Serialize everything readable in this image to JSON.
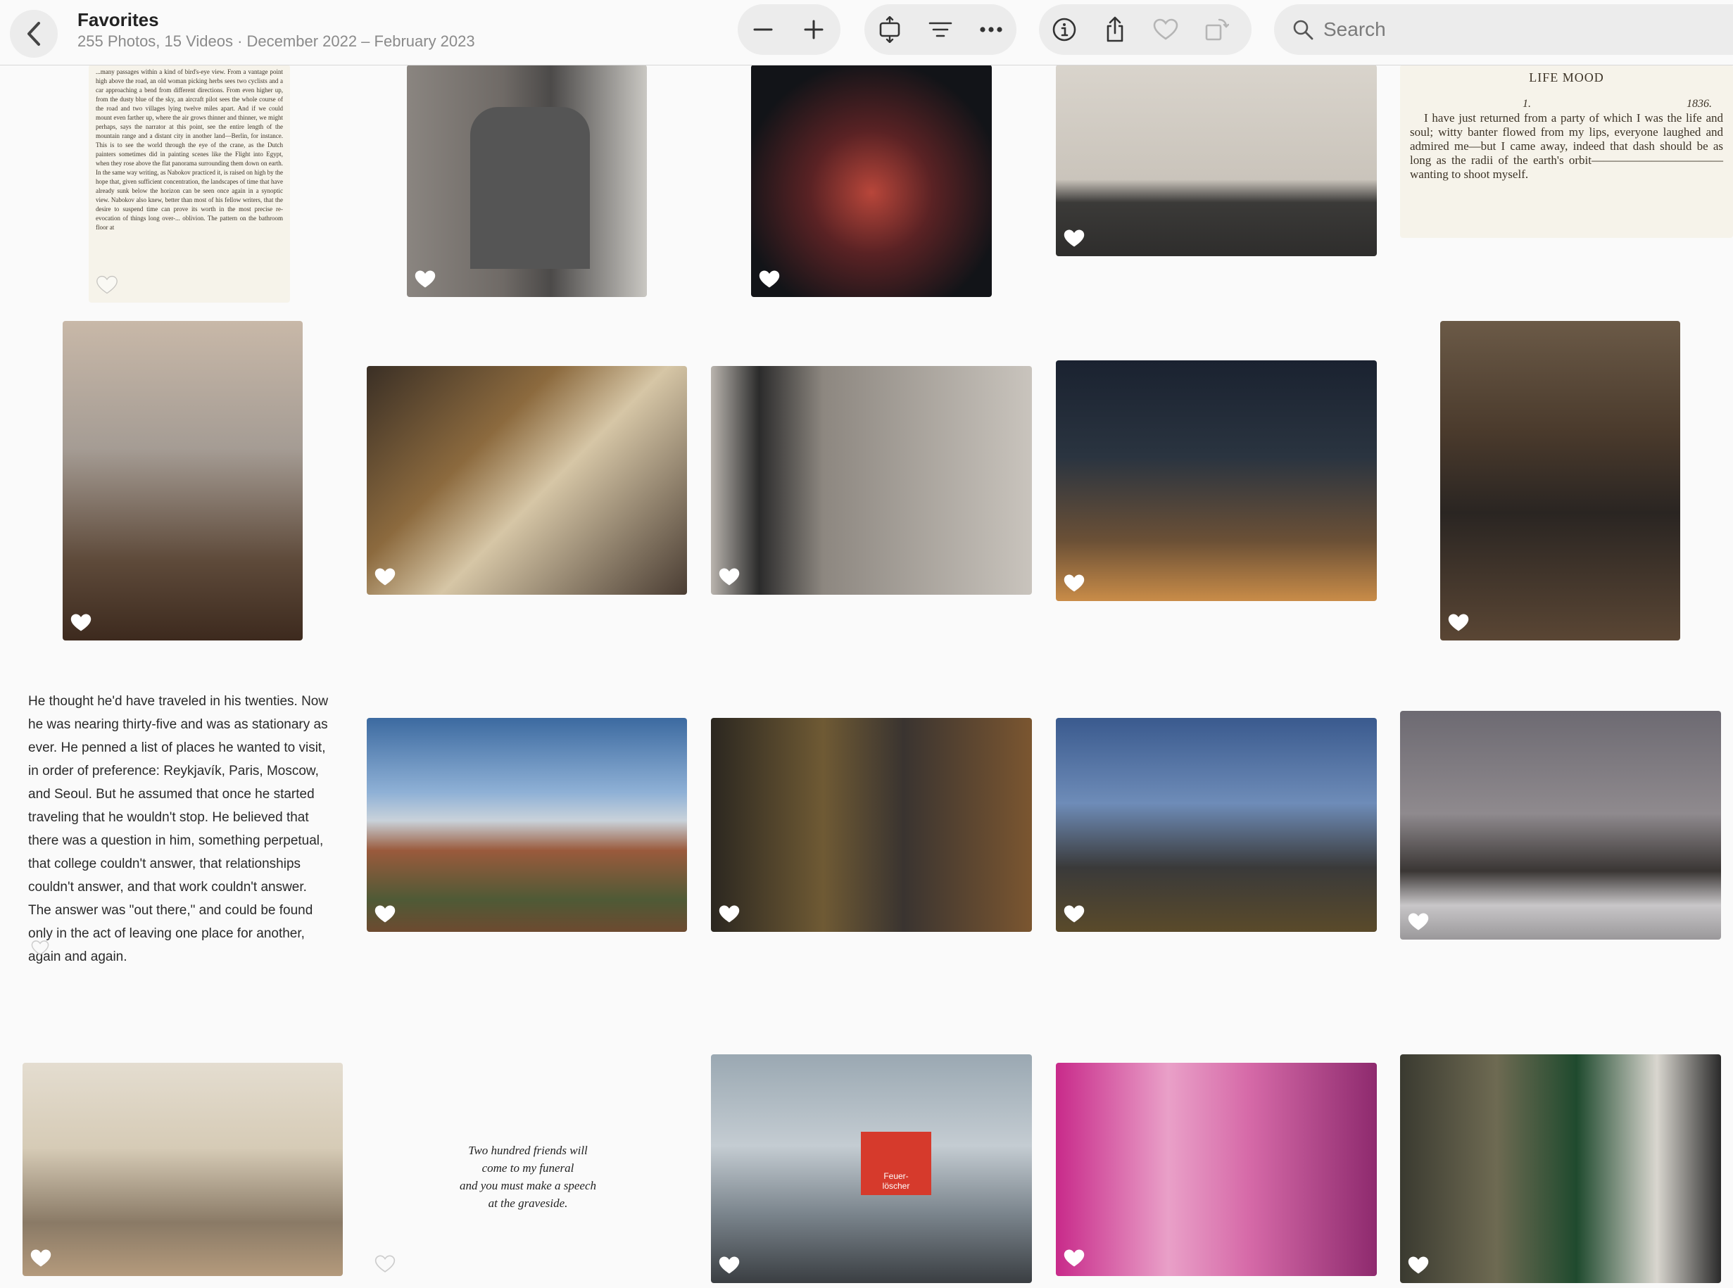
{
  "toolbar": {
    "title": "Favorites",
    "subtitle": "255 Photos, 15 Videos · December 2022 – February 2023",
    "search_placeholder": "Search",
    "icons": [
      "chevron-left-icon",
      "minus-icon",
      "plus-icon",
      "aspect-ratio-icon",
      "filter-icon",
      "ellipsis-icon",
      "info-icon",
      "share-icon",
      "heart-icon",
      "rotate-icon",
      "search-icon"
    ]
  },
  "colors": {
    "heart_white": "#ffffff",
    "toolbar_bg": "#fafafa",
    "pill_bg": "#ececec"
  },
  "texts": {
    "book_page_top": "...many passages within a kind of bird's-eye view. From a vantage point high above the road, an old woman picking herbs sees two cyclists and a car approaching a bend from different directions. From even higher up, from the dusty blue of the sky, an aircraft pilot sees the whole course of the road and two villages lying twelve miles apart. And if we could mount even farther up, where the air grows thinner and thinner, we might perhaps, says the narrator at this point, see the entire length of the mountain range and a distant city in another land—Berlin, for instance. This is to see the world through the eye of the crane, as the Dutch painters sometimes did in painting scenes like the Flight into Egypt, when they rose above the flat panorama surrounding them down on earth. In the same way writing, as Nabokov practiced it, is raised on high by the hope that, given sufficient concentration, the landscapes of time that have already sunk below the horizon can be seen once again in a synoptic view. Nabokov also knew, better than most of his fellow writers, that the desire to suspend time can prove its worth in the most precise re-evocation of things long over-... oblivion. The pattern on the bathroom floor at",
    "life_mood_header": "LIFE MOOD",
    "life_mood_number": "1.",
    "life_mood_year": "1836.",
    "life_mood_body": "I have just returned from a party of which I was the life and soul; witty banter flowed from my lips, everyone laughed and admired me—but I came away, indeed that dash should be as long as the radii of the earth's orbit———————————wanting to shoot myself.",
    "quote": "He thought he'd have traveled in his twenties. Now he was nearing thirty-five and was as stationary as ever. He penned a list of places he wanted to visit, in order of preference: Reykjavík, Paris, Moscow, and Seoul. But he assumed that once he started traveling that he wouldn't stop. He believed that there was a question in him, something perpetual, that college couldn't answer, that relationships couldn't answer, and that work couldn't answer. The answer was \"out there,\" and could be found only in the act of leaving one place for another, again and again.",
    "poem_l1": "Two hundred friends will",
    "poem_l2": "come to my funeral",
    "poem_l3": "and you must make a speech",
    "poem_l4": "at the graveside.",
    "sign_l1": "Feuer-",
    "sign_l2": "löscher"
  }
}
